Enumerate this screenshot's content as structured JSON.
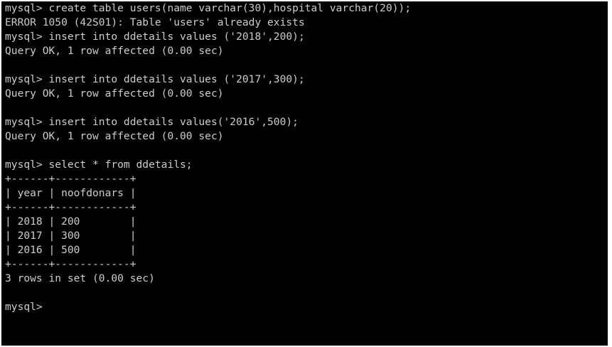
{
  "terminal": {
    "lines": [
      "mysql> create table users(name varchar(30),hospital varchar(20));",
      "ERROR 1050 (42S01): Table 'users' already exists",
      "mysql> insert into ddetails values ('2018',200);",
      "Query OK, 1 row affected (0.00 sec)",
      "",
      "mysql> insert into ddetails values ('2017',300);",
      "Query OK, 1 row affected (0.00 sec)",
      "",
      "mysql> insert into ddetails values('2016',500);",
      "Query OK, 1 row affected (0.00 sec)",
      "",
      "mysql> select * from ddetails;",
      "+------+------------+",
      "| year | noofdonars |",
      "+------+------------+",
      "| 2018 | 200        |",
      "| 2017 | 300        |",
      "| 2016 | 500        |",
      "+------+------------+",
      "3 rows in set (0.00 sec)",
      "",
      "mysql>"
    ]
  },
  "colors": {
    "background": "#000000",
    "text": "#cccccc"
  }
}
